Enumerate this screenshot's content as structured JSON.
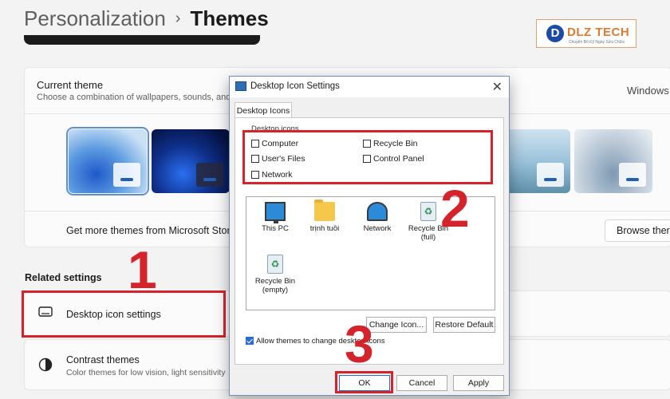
{
  "breadcrumb": {
    "parent": "Personalization",
    "separator": "›",
    "current": "Themes"
  },
  "logo": {
    "mark": "D",
    "name": "DLZ TECH",
    "tagline": "Chuyên Bổ Kỹ Ngày Sửa Chữa"
  },
  "current_theme": {
    "title": "Current theme",
    "subtitle": "Choose a combination of wallpapers, sounds, and",
    "value": "Windows"
  },
  "more_themes": {
    "label": "Get more themes from Microsoft Stor",
    "button": "Browse ther"
  },
  "related": {
    "heading": "Related settings",
    "desktop_icon_settings": "Desktop icon settings",
    "contrast_title": "Contrast themes",
    "contrast_sub": "Color themes for low vision, light sensitivity"
  },
  "callouts": [
    "1",
    "2",
    "3"
  ],
  "dialog": {
    "title": "Desktop Icon Settings",
    "close": "✕",
    "tab": "Desktop Icons",
    "group_label": "Desktop icons",
    "checkboxes": [
      {
        "label": "Computer",
        "checked": false
      },
      {
        "label": "Recycle Bin",
        "checked": false
      },
      {
        "label": "User's Files",
        "checked": false
      },
      {
        "label": "Control Panel",
        "checked": false
      },
      {
        "label": "Network",
        "checked": false
      }
    ],
    "icons": [
      {
        "label": "This PC",
        "type": "monitor-icon"
      },
      {
        "label": "trịnh tuồi",
        "type": "folder-icon"
      },
      {
        "label": "Network",
        "type": "network-icon"
      },
      {
        "label": "Recycle Bin (full)",
        "type": "recycle-bin-full-icon"
      },
      {
        "label": "Recycle Bin (empty)",
        "type": "recycle-bin-empty-icon"
      }
    ],
    "change_icon": "Change Icon...",
    "restore_default": "Restore Default",
    "allow_themes": "Allow themes to change desktop icons",
    "allow_themes_checked": true,
    "ok": "OK",
    "cancel": "Cancel",
    "apply": "Apply"
  },
  "colors": {
    "accent": "#1f6fd1",
    "callout_red": "#d4232b",
    "logo_orange": "#e07a2e",
    "logo_blue": "#1c4aa6"
  }
}
